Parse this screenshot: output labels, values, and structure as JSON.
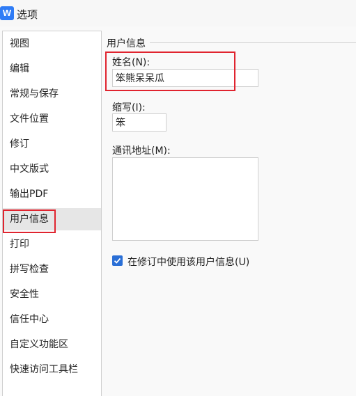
{
  "window": {
    "title": "选项",
    "app_icon": "W",
    "app_icon_color": "#2f7cf6"
  },
  "sidebar": {
    "selected_index": 8,
    "items": [
      {
        "label": "视图"
      },
      {
        "label": "编辑"
      },
      {
        "label": "常规与保存"
      },
      {
        "label": "文件位置"
      },
      {
        "label": "修订"
      },
      {
        "label": "中文版式"
      },
      {
        "label": "输出PDF"
      },
      {
        "label": "用户信息"
      },
      {
        "label": "打印"
      },
      {
        "label": "拼写检查"
      },
      {
        "label": "安全性"
      },
      {
        "label": "信任中心"
      },
      {
        "label": "自定义功能区"
      },
      {
        "label": "快速访问工具栏"
      }
    ]
  },
  "user_info": {
    "group_title": "用户信息",
    "name_label": "姓名(N):",
    "name_value": "笨熊呆呆瓜",
    "initials_label": "缩写(I):",
    "initials_value": "笨",
    "address_label": "通讯地址(M):",
    "address_value": "",
    "use_in_revisions_label": "在修订中使用该用户信息(U)",
    "use_in_revisions_checked": true
  },
  "colors": {
    "highlight_border": "#e0242f",
    "checkbox_accent": "#2a6fd6"
  }
}
